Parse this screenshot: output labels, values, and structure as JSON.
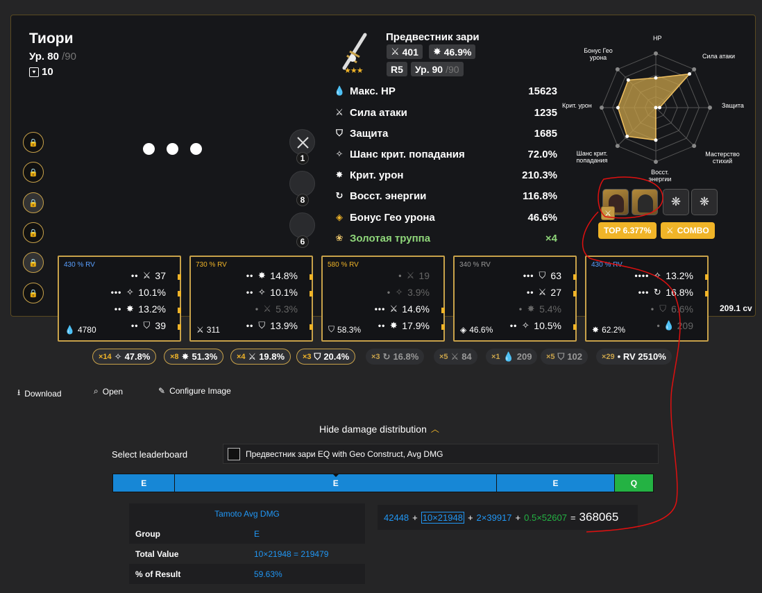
{
  "character": {
    "name": "Тиори",
    "level_prefix": "Ур. 80",
    "level_max": "/90",
    "constellation": "10"
  },
  "weapon": {
    "name": "Предвестник зари",
    "atk": "401",
    "sub": "46.9%",
    "refine": "R5",
    "level_prefix": "Ур. 90",
    "level_max": "/90",
    "stars": "★★★"
  },
  "talents": [
    "1",
    "8",
    "6"
  ],
  "stats": [
    {
      "label": "Макс. HP",
      "value": "15623",
      "icon": "hp-icon"
    },
    {
      "label": "Сила атаки",
      "value": "1235",
      "icon": "atk-icon"
    },
    {
      "label": "Защита",
      "value": "1685",
      "icon": "def-icon"
    },
    {
      "label": "Шанс крит. попадания",
      "value": "72.0%",
      "icon": "crit-rate-icon"
    },
    {
      "label": "Крит. урон",
      "value": "210.3%",
      "icon": "crit-dmg-icon"
    },
    {
      "label": "Восст. энергии",
      "value": "116.8%",
      "icon": "energy-icon"
    },
    {
      "label": "Бонус Гео урона",
      "value": "46.6%",
      "icon": "geo-icon"
    }
  ],
  "set_bonus": {
    "label": "Золотая труппа",
    "value": "×4"
  },
  "radar": {
    "labels": {
      "hp": "HP",
      "atk": "Сила атаки",
      "def": "Защита",
      "em": "Мастерство стихий",
      "er": "Восст. энергии",
      "cr": "Шанс крит. попадания",
      "cd": "Крит. урон",
      "geo": "Бонус Гео урона"
    },
    "values": {
      "hp": 0.55,
      "atk": 0.88,
      "def": 0.07,
      "em": 0.0,
      "er": 0.6,
      "cr": 0.75,
      "cd": 0.7,
      "geo": 0.72
    },
    "color": "#c8a24a"
  },
  "badges": {
    "top": "TOP 6.377%",
    "combo": "COMBO"
  },
  "artifacts": [
    {
      "rv": "430 % RV",
      "rv_color": "#5aa0ff",
      "main": "4780",
      "main_icon": "hp-icon",
      "subs": [
        {
          "rolls": "••",
          "icon": "atk-icon",
          "value": "37",
          "dim": false
        },
        {
          "rolls": "•••",
          "icon": "crit-rate-icon",
          "value": "10.1%",
          "dim": false
        },
        {
          "rolls": "••",
          "icon": "crit-dmg-icon",
          "value": "13.2%",
          "dim": false
        },
        {
          "rolls": "••",
          "icon": "def-icon",
          "value": "39",
          "dim": false
        }
      ]
    },
    {
      "rv": "730 % RV",
      "rv_color": "#f0b428",
      "main": "311",
      "main_icon": "atk-icon",
      "subs": [
        {
          "rolls": "••",
          "icon": "crit-dmg-icon",
          "value": "14.8%",
          "dim": false
        },
        {
          "rolls": "••",
          "icon": "crit-rate-icon",
          "value": "10.1%",
          "dim": false
        },
        {
          "rolls": "•",
          "icon": "atk-pct-icon",
          "value": "5.3%",
          "dim": true
        },
        {
          "rolls": "••",
          "icon": "def-pct-icon",
          "value": "13.9%",
          "dim": false
        }
      ]
    },
    {
      "rv": "580 % RV",
      "rv_color": "#f0b428",
      "main": "58.3%",
      "main_icon": "def-pct-icon",
      "subs": [
        {
          "rolls": "•",
          "icon": "atk-icon",
          "value": "19",
          "dim": true
        },
        {
          "rolls": "•",
          "icon": "crit-rate-icon",
          "value": "3.9%",
          "dim": true
        },
        {
          "rolls": "•••",
          "icon": "atk-pct-icon",
          "value": "14.6%",
          "dim": false
        },
        {
          "rolls": "••",
          "icon": "crit-dmg-icon",
          "value": "17.9%",
          "dim": false
        }
      ]
    },
    {
      "rv": "340 % RV",
      "rv_color": "#999999",
      "main": "46.6%",
      "main_icon": "geo-icon",
      "subs": [
        {
          "rolls": "•••",
          "icon": "def-icon",
          "value": "63",
          "dim": false
        },
        {
          "rolls": "••",
          "icon": "atk-icon",
          "value": "27",
          "dim": false
        },
        {
          "rolls": "•",
          "icon": "crit-dmg-icon",
          "value": "5.4%",
          "dim": true
        },
        {
          "rolls": "••",
          "icon": "crit-rate-icon",
          "value": "10.5%",
          "dim": false
        }
      ]
    },
    {
      "rv": "430 % RV",
      "rv_color": "#5aa0ff",
      "main": "62.2%",
      "main_icon": "crit-dmg-icon",
      "subs": [
        {
          "rolls": "••••",
          "icon": "crit-rate-icon",
          "value": "13.2%",
          "dim": false
        },
        {
          "rolls": "•••",
          "icon": "energy-icon",
          "value": "16.8%",
          "dim": false
        },
        {
          "rolls": "•",
          "icon": "def-pct-icon",
          "value": "6.6%",
          "dim": true
        },
        {
          "rolls": "•",
          "icon": "hp-icon",
          "value": "209",
          "dim": true
        }
      ]
    }
  ],
  "crit_value": "209.1 cv",
  "roll_chips": [
    {
      "mult": "×14",
      "icon": "crit-rate-icon",
      "value": "47.8%",
      "gold": true
    },
    {
      "mult": "×8",
      "icon": "crit-dmg-icon",
      "value": "51.3%",
      "gold": true
    },
    {
      "mult": "×4",
      "icon": "atk-pct-icon",
      "value": "19.8%",
      "gold": true
    },
    {
      "mult": "×3",
      "icon": "def-pct-icon",
      "value": "20.4%",
      "gold": true
    },
    {
      "mult": "×3",
      "icon": "energy-icon",
      "value": "16.8%",
      "gold": false
    },
    {
      "mult": "×5",
      "icon": "atk-icon",
      "value": "84",
      "gold": false
    },
    {
      "mult": "×1",
      "icon": "hp-icon",
      "value": "209",
      "gold": false
    },
    {
      "mult": "×5",
      "icon": "def-icon",
      "value": "102",
      "gold": false
    },
    {
      "mult": "×29",
      "icon": "",
      "value": "• RV 2510%",
      "gold": false
    }
  ],
  "toolbar": {
    "download": "Download",
    "open": "Open",
    "configure": "Configure Image"
  },
  "damage": {
    "hide_label": "Hide damage distribution",
    "leaderboard_label": "Select leaderboard",
    "leaderboard_value": "Предвестник зари EQ with Geo Construct, Avg DMG",
    "segments": [
      {
        "label": "E",
        "share": 11.5,
        "type": "e"
      },
      {
        "label": "E",
        "share": 59.6,
        "type": "e"
      },
      {
        "label": "E",
        "share": 21.8,
        "type": "e"
      },
      {
        "label": "Q",
        "share": 7.1,
        "type": "q"
      }
    ],
    "tooltip": {
      "title": "Tamoto Avg DMG",
      "rows": [
        {
          "key": "Group",
          "value": "E"
        },
        {
          "key": "Total Value",
          "value": "10×21948 = 219479"
        },
        {
          "key": "% of Result",
          "value": "59.63%"
        }
      ]
    },
    "formula": {
      "t1": "42448",
      "plus": "+",
      "t2": "10×21948",
      "t3": "2×39917",
      "t4": "0.5×52607",
      "eq": "=",
      "result": "368065"
    }
  }
}
